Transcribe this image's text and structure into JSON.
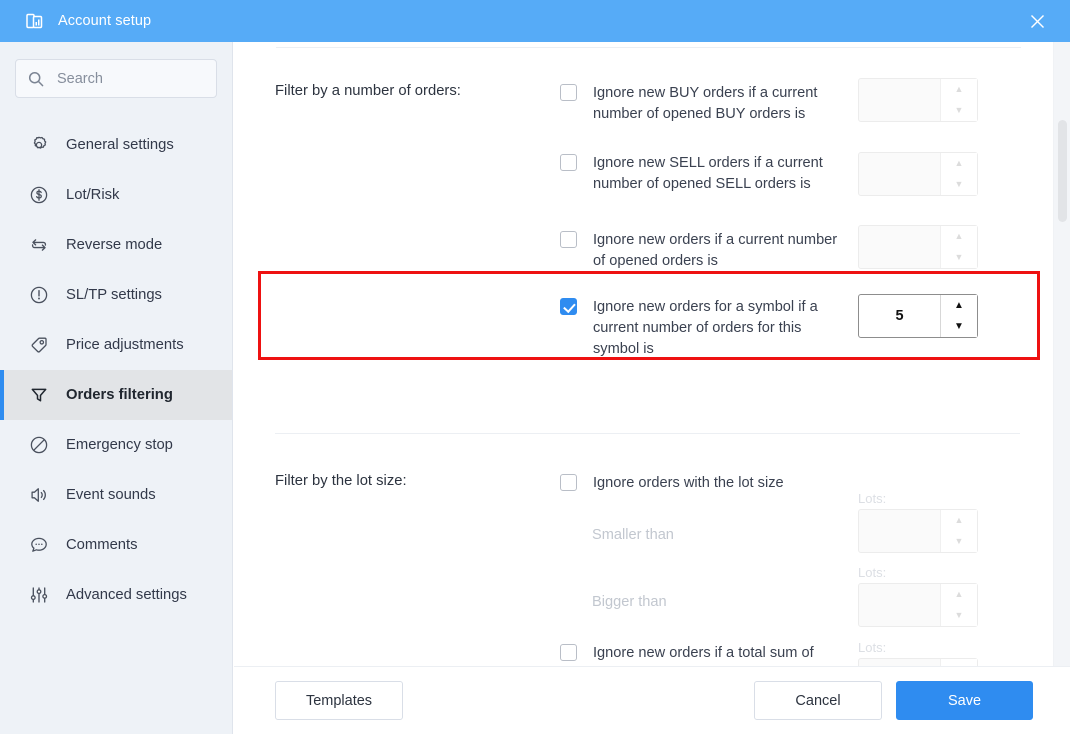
{
  "titlebar": {
    "title": "Account setup",
    "app_icon": "document-chart-icon",
    "close_icon": "close-icon",
    "background_color": "#56abf7"
  },
  "sidebar": {
    "search": {
      "placeholder": "Search",
      "value": "",
      "icon": "search-icon"
    },
    "items": [
      {
        "label": "General settings",
        "icon": "gear-icon",
        "active": false
      },
      {
        "label": "Lot/Risk",
        "icon": "dollar-circle-icon",
        "active": false
      },
      {
        "label": "Reverse mode",
        "icon": "swap-arrows-icon",
        "active": false
      },
      {
        "label": "SL/TP settings",
        "icon": "exclamation-circle-icon",
        "active": false
      },
      {
        "label": "Price adjustments",
        "icon": "tag-icon",
        "active": false
      },
      {
        "label": "Orders filtering",
        "icon": "funnel-icon",
        "active": true
      },
      {
        "label": "Emergency stop",
        "icon": "no-entry-icon",
        "active": false
      },
      {
        "label": "Event sounds",
        "icon": "speaker-icon",
        "active": false
      },
      {
        "label": "Comments",
        "icon": "chat-bubble-icon",
        "active": false
      },
      {
        "label": "Advanced settings",
        "icon": "sliders-icon",
        "active": false
      }
    ]
  },
  "main": {
    "section_orders": {
      "title": "Filter by a number of orders:",
      "rows": [
        {
          "label": "Ignore new BUY orders if a current number of opened BUY orders is",
          "checked": false,
          "spinner_value": "",
          "spinner_enabled": false
        },
        {
          "label": "Ignore new SELL orders if a current number of opened SELL orders is",
          "checked": false,
          "spinner_value": "",
          "spinner_enabled": false
        },
        {
          "label": "Ignore new orders if a current number of opened orders is",
          "checked": false,
          "spinner_value": "",
          "spinner_enabled": false
        },
        {
          "label": "Ignore new orders for a symbol if a current number of orders for this symbol is",
          "checked": true,
          "spinner_value": "5",
          "spinner_enabled": true,
          "highlighted": true
        }
      ]
    },
    "section_lot": {
      "title": "Filter by the lot size:",
      "rows": [
        {
          "label": "Ignore orders with the lot size",
          "checked": false,
          "has_spinner": false
        },
        {
          "label": "Smaller than",
          "muted": true,
          "lots_label": "Lots:",
          "spinner_value": "",
          "spinner_enabled": false
        },
        {
          "label": "Bigger than",
          "muted": true,
          "lots_label": "Lots:",
          "spinner_value": "",
          "spinner_enabled": false
        },
        {
          "label": "Ignore new orders if a total sum of current orders lots is at least",
          "checked": false,
          "lots_label": "Lots:",
          "spinner_value": "",
          "spinner_enabled": false
        }
      ]
    },
    "spinner_up_glyph": "▲",
    "spinner_down_glyph": "▼"
  },
  "footer": {
    "templates_label": "Templates",
    "cancel_label": "Cancel",
    "save_label": "Save",
    "save_color": "#2f8cf0"
  },
  "scrollbar": {
    "thumb_position_percent": 13
  },
  "highlight": {
    "color": "#ee1111"
  }
}
